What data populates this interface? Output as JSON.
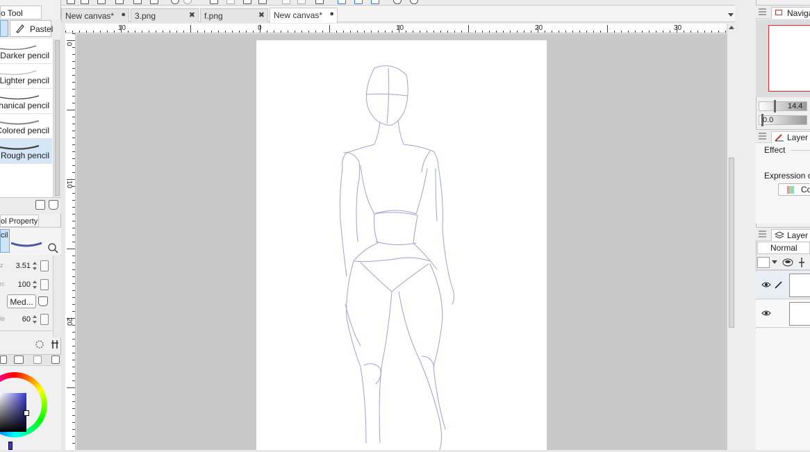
{
  "sub_tool": {
    "title": "o Tool",
    "active_group_tab": "Pastel",
    "brushes": [
      {
        "label": "Darker pencil",
        "selected": false
      },
      {
        "label": "Lighter pencil",
        "selected": false
      },
      {
        "label": "chanical pencil",
        "selected": false
      },
      {
        "label": "Colored pencil",
        "selected": false
      },
      {
        "label": "Rough pencil",
        "selected": true
      }
    ]
  },
  "tool_property": {
    "title": "ol Property",
    "tool_name": "cil",
    "size_label": "z",
    "size_value": "3.51",
    "density_label": "n:",
    "density_value": "100",
    "mode_label": "Med...",
    "stab_label": "le",
    "stab_value": "60"
  },
  "documents": {
    "tabs": [
      {
        "label": "New canvas*",
        "close": "●",
        "active": false
      },
      {
        "label": "3.png",
        "close": "✖",
        "active": false
      },
      {
        "label": "f.png",
        "close": "✖",
        "active": false
      },
      {
        "label": "New canvas*",
        "close": "●",
        "active": true
      }
    ]
  },
  "ruler": {
    "top_labels": [
      "10",
      "0",
      "10",
      "20",
      "30"
    ],
    "left_labels": [
      "0",
      "10",
      "20"
    ]
  },
  "navigator": {
    "title": "Navigat",
    "zoom_value": "14.4",
    "rotate_value": "0.0"
  },
  "layer_property": {
    "title": "Layer P",
    "effect_label": "Effect",
    "expression_label": "Expression c",
    "color_button": "Co"
  },
  "layers": {
    "title": "Layer",
    "blend_mode": "Normal"
  },
  "colors": {
    "accent": "#3a38d8",
    "selection": "#d4e6f7",
    "nav_frame": "#e02828",
    "sketch": "#8f92c4"
  }
}
